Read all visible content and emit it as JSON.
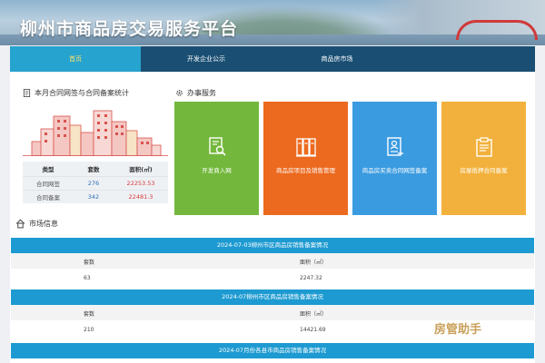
{
  "site_title": "柳州市商品房交易服务平台",
  "nav": [
    {
      "label": "首页"
    },
    {
      "label": "开发企业公示"
    },
    {
      "label": "商品房市场"
    }
  ],
  "stats": {
    "title": "本月合同网签与合同备案统计",
    "headers": [
      "类型",
      "套数",
      "面积(㎡)"
    ],
    "rows": [
      {
        "type": "合同网签",
        "count": "276",
        "area": "22253.53"
      },
      {
        "type": "合同备案",
        "count": "342",
        "area": "22481.3"
      }
    ]
  },
  "services": {
    "title": "办事服务",
    "tiles": [
      {
        "label": "开发商入网",
        "color": "#73b83c",
        "icon": "search-doc-icon"
      },
      {
        "label": "商品房项目及销售管理",
        "color": "#ec6a1f",
        "icon": "binders-icon"
      },
      {
        "label": "商品房买卖合同网签备案",
        "color": "#3b9be0",
        "icon": "id-card-icon"
      },
      {
        "label": "房屋抵押合同备案",
        "color": "#f2b13c",
        "icon": "clipboard-icon"
      }
    ]
  },
  "market": {
    "title": "市场信息",
    "sections": [
      {
        "heading": "2024-07-03柳州市区商品房销售备案情况",
        "col1_label": "套数",
        "col2_label": "面积（㎡）",
        "col1_value": "63",
        "col2_value": "2247.32"
      },
      {
        "heading": "2024-07柳州市区商品房销售备案情况",
        "col1_label": "套数",
        "col2_label": "面积（㎡）",
        "col1_value": "210",
        "col2_value": "14421.69"
      },
      {
        "heading": "2024-07月份各县市商品房销售备案情况"
      }
    ]
  },
  "watermark": "房管助手"
}
